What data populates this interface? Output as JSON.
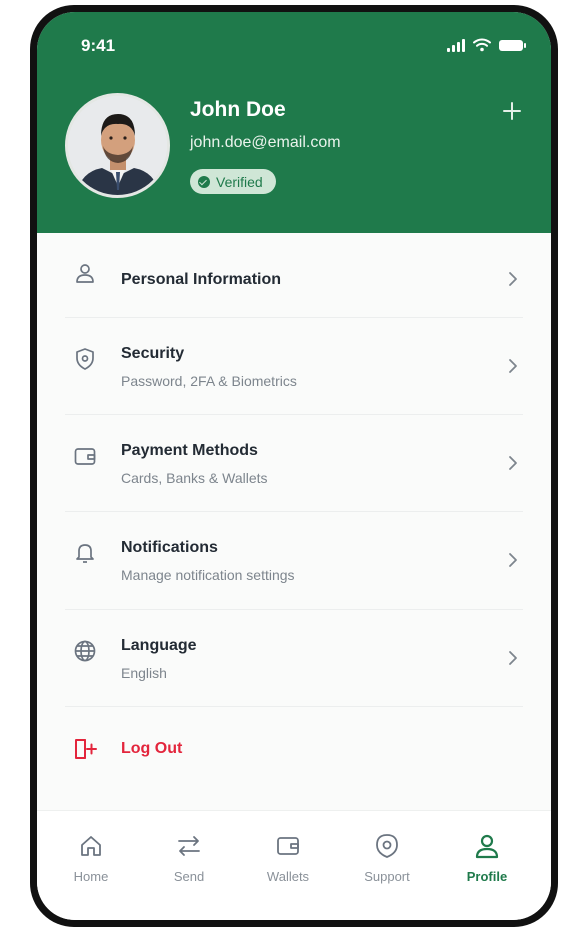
{
  "status_bar": {
    "time": "9:41"
  },
  "profile": {
    "name": "John Doe",
    "email": "john.doe@email.com",
    "badge": "Verified"
  },
  "menu": [
    {
      "title": "Personal Information",
      "subtitle": "",
      "icon": "user-icon"
    },
    {
      "title": "Security",
      "subtitle": "Password, 2FA & Biometrics",
      "icon": "shield-icon"
    },
    {
      "title": "Payment Methods",
      "subtitle": "Cards, Banks & Wallets",
      "icon": "wallet-icon"
    },
    {
      "title": "Notifications",
      "subtitle": "Manage notification settings",
      "icon": "bell-icon"
    },
    {
      "title": "Language",
      "subtitle": "English",
      "icon": "globe-icon"
    }
  ],
  "logout": {
    "label": "Log Out",
    "color": "#e3253c"
  },
  "tabs": [
    {
      "label": "Home",
      "icon": "home-icon"
    },
    {
      "label": "Send",
      "icon": "transfer-icon"
    },
    {
      "label": "Wallets",
      "icon": "wallet-icon"
    },
    {
      "label": "Support",
      "icon": "support-icon"
    },
    {
      "label": "Profile",
      "icon": "profile-icon",
      "active": true
    }
  ],
  "colors": {
    "brand": "#1f7a4b",
    "danger": "#e3253c"
  }
}
